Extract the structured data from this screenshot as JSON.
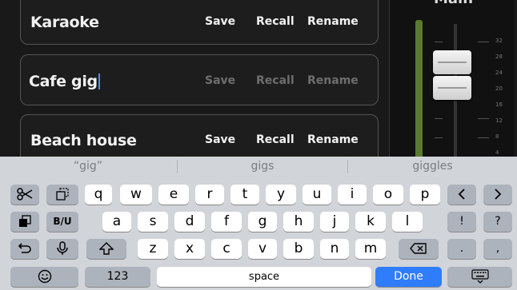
{
  "presets": [
    {
      "name": "Karaoke",
      "save": "Save",
      "recall": "Recall",
      "rename": "Rename"
    },
    {
      "name": "Cafe gig",
      "save": "Save",
      "recall": "Recall",
      "rename": "Rename",
      "editing": true
    },
    {
      "name": "Beach house",
      "save": "Save",
      "recall": "Recall",
      "rename": "Rename"
    }
  ],
  "side_panel": {
    "title": "Main",
    "scale": [
      "32",
      "28",
      "24",
      "20",
      "16",
      "12",
      "8",
      "4"
    ]
  },
  "keyboard": {
    "suggestions": [
      "“gig”",
      "gigs",
      "giggles"
    ],
    "row1": [
      "q",
      "w",
      "e",
      "r",
      "t",
      "y",
      "u",
      "i",
      "o",
      "p"
    ],
    "row2": [
      "a",
      "s",
      "d",
      "f",
      "g",
      "h",
      "j",
      "k",
      "l"
    ],
    "row3": [
      "z",
      "x",
      "c",
      "v",
      "b",
      "n",
      "m"
    ],
    "numbers_label": "123",
    "space_label": "space",
    "done_label": "Done",
    "bold_label": "B/U",
    "exclaim": "!",
    "question": "?",
    "period": ".",
    "comma": ","
  },
  "colors": {
    "accent": "#2f7dfb",
    "meter": "#5a7a2e"
  }
}
